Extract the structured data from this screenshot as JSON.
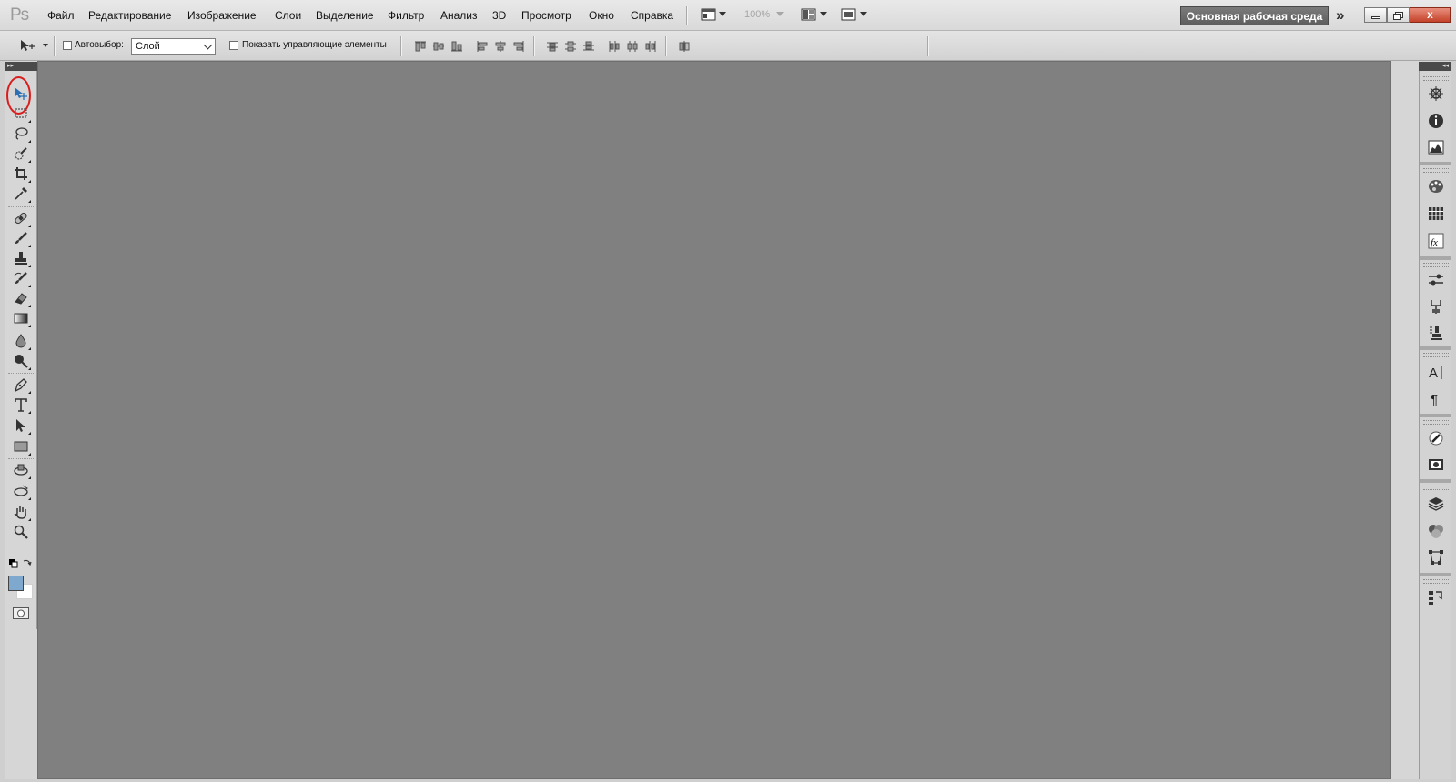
{
  "app": {
    "logo_text": "Ps"
  },
  "menu": {
    "items": [
      "Файл",
      "Редактирование",
      "Изображение",
      "Слои",
      "Выделение",
      "Фильтр",
      "Анализ",
      "3D",
      "Просмотр",
      "Окно",
      "Справка"
    ]
  },
  "appbar": {
    "zoom_level": "100%",
    "workspace_label": "Основная рабочая среда",
    "more_label": "»",
    "close_label": "x"
  },
  "options": {
    "auto_select_label": "Автовыбор:",
    "auto_select_value": "Слой",
    "show_controls_label": "Показать управляющие элементы"
  },
  "toolbar": {
    "tools": [
      "move-tool",
      "rectangular-marquee-tool",
      "lasso-tool",
      "quick-selection-tool",
      "crop-tool",
      "eyedropper-tool",
      "spot-healing-brush-tool",
      "brush-tool",
      "clone-stamp-tool",
      "history-brush-tool",
      "eraser-tool",
      "gradient-tool",
      "blur-tool",
      "dodge-tool",
      "pen-tool",
      "type-tool",
      "path-selection-tool",
      "rectangle-tool",
      "3d-rotate-tool",
      "3d-orbit-tool",
      "hand-tool",
      "zoom-tool"
    ],
    "foreground_color": "#7fa8cf",
    "background_color": "#ffffff",
    "highlight_color": "#d91c1c",
    "selected_tool": "move-tool"
  },
  "dock": {
    "panels": [
      "navigator",
      "info",
      "histogram",
      "color",
      "swatches",
      "styles",
      "adjustments",
      "masks",
      "clone-source",
      "character",
      "paragraph",
      "brushes",
      "tool-presets",
      "layers",
      "channels",
      "paths",
      "history"
    ]
  },
  "colors": {
    "canvas_background": "#808080",
    "panel_background": "#d6d6d6",
    "workspace_button": "#6a6a6a"
  }
}
